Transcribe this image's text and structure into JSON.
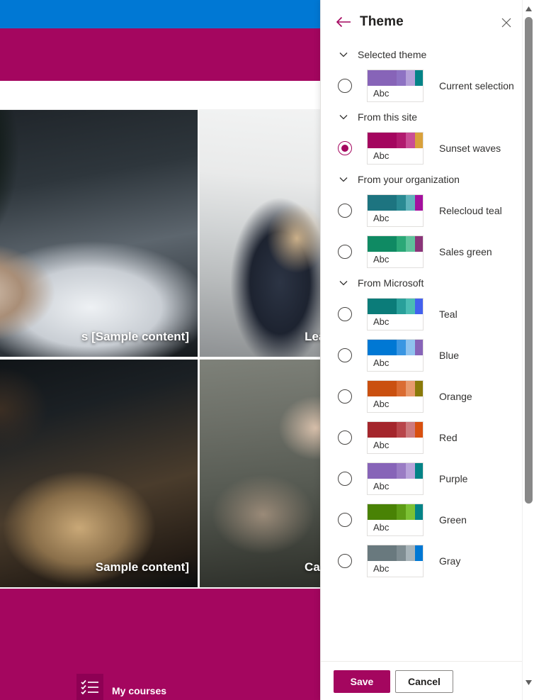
{
  "site": {
    "suite_bar_color": "#0078d4",
    "header_color": "#a4065f",
    "cards": [
      {
        "title": "s [Sample content]",
        "image": "handshake-photo"
      },
      {
        "title": "Learn a new lang",
        "image": "meeting-photo"
      },
      {
        "title": "Sample content]",
        "image": "desk-photo"
      },
      {
        "title": "Career developm",
        "image": "hands-photo"
      }
    ],
    "footer": {
      "tile_label": "My courses",
      "tile_icon": "checklist-icon",
      "band_color": "#a4065f"
    }
  },
  "panel": {
    "title": "Theme",
    "back_icon": "arrow-left-icon",
    "close_icon": "close-icon",
    "groups": [
      {
        "label": "Selected theme",
        "chevron": "chevron-down-icon",
        "themes": [
          {
            "name": "Current selection",
            "selected": false,
            "sample_text": "Abc",
            "colors": [
              "#8764b8",
              "#8e72c3",
              "#b4a0d8",
              "#038387"
            ]
          }
        ]
      },
      {
        "label": "From this site",
        "chevron": "chevron-down-icon",
        "themes": [
          {
            "name": "Sunset waves",
            "selected": true,
            "sample_text": "Abc",
            "colors": [
              "#a4065f",
              "#b11a6e",
              "#ca4d96",
              "#d9a13b"
            ]
          }
        ]
      },
      {
        "label": "From your organization",
        "chevron": "chevron-down-icon",
        "themes": [
          {
            "name": "Relecloud teal",
            "selected": false,
            "sample_text": "Abc",
            "colors": [
              "#1d7480",
              "#2a8a93",
              "#5fb3bb",
              "#a4109e"
            ]
          },
          {
            "name": "Sales green",
            "selected": false,
            "sample_text": "Abc",
            "colors": [
              "#0f8a63",
              "#2ba877",
              "#5ec39b",
              "#8a3579"
            ]
          }
        ]
      },
      {
        "label": "From Microsoft",
        "chevron": "chevron-down-icon",
        "themes": [
          {
            "name": "Teal",
            "selected": false,
            "sample_text": "Abc",
            "colors": [
              "#0b7c79",
              "#29a09a",
              "#4bbdb3",
              "#4361ee"
            ]
          },
          {
            "name": "Blue",
            "selected": false,
            "sample_text": "Abc",
            "colors": [
              "#0078d4",
              "#3a96e2",
              "#8fc3ef",
              "#8764b8"
            ]
          },
          {
            "name": "Orange",
            "selected": false,
            "sample_text": "Abc",
            "colors": [
              "#ca5010",
              "#da6c32",
              "#e89a6d",
              "#8a7a0a"
            ]
          },
          {
            "name": "Red",
            "selected": false,
            "sample_text": "Abc",
            "colors": [
              "#a4262c",
              "#b8454a",
              "#cc7a7e",
              "#d9500f"
            ]
          },
          {
            "name": "Purple",
            "selected": false,
            "sample_text": "Abc",
            "colors": [
              "#8764b8",
              "#9a7cc4",
              "#b9a4da",
              "#038387"
            ]
          },
          {
            "name": "Green",
            "selected": false,
            "sample_text": "Abc",
            "colors": [
              "#498205",
              "#5d9c16",
              "#7cc134",
              "#038387"
            ]
          },
          {
            "name": "Gray",
            "selected": false,
            "sample_text": "Abc",
            "colors": [
              "#69797e",
              "#7f8d92",
              "#a8b4b9",
              "#0078d4"
            ]
          }
        ]
      }
    ],
    "footer": {
      "save_label": "Save",
      "cancel_label": "Cancel",
      "save_color": "#a4065f"
    }
  },
  "scrollbar": {
    "up_icon": "triangle-up-icon",
    "down_icon": "triangle-down-icon"
  }
}
